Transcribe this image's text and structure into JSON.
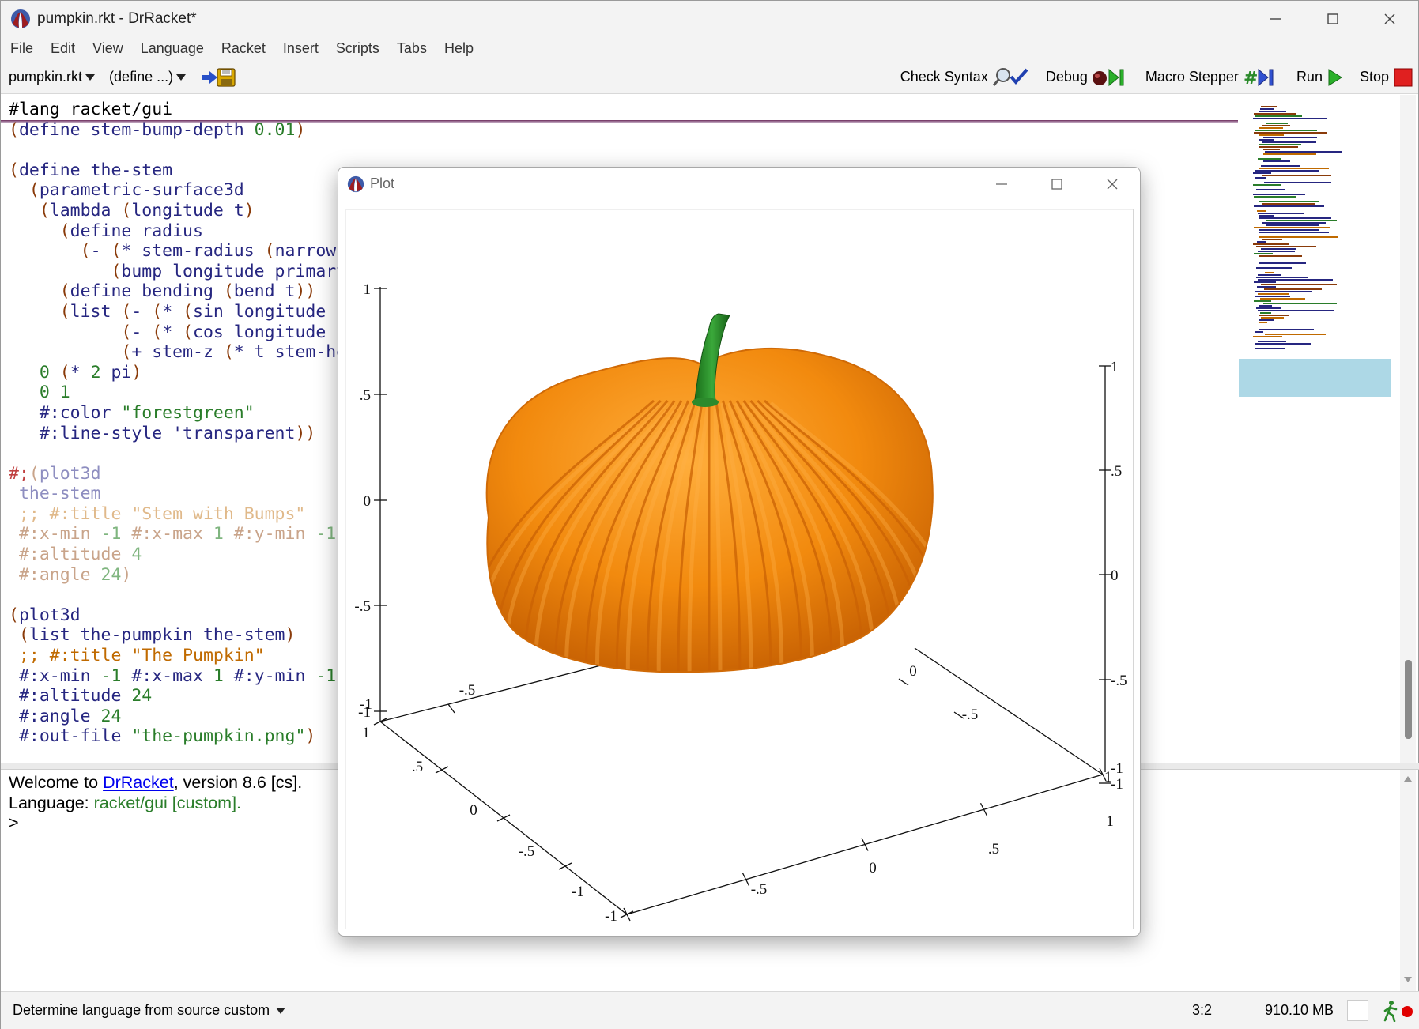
{
  "window": {
    "title": "pumpkin.rkt - DrRacket*"
  },
  "menu": [
    "File",
    "Edit",
    "View",
    "Language",
    "Racket",
    "Insert",
    "Scripts",
    "Tabs",
    "Help"
  ],
  "toolbar": {
    "file_dropdown": "pumpkin.rkt",
    "define_dropdown": "(define ...)",
    "check_syntax": "Check Syntax",
    "debug": "Debug",
    "macro_stepper": "Macro Stepper",
    "run": "Run",
    "stop": "Stop"
  },
  "editor": {
    "lines": [
      [
        {
          "t": "#lang racket/gui",
          "c": "c-blk"
        }
      ],
      [
        {
          "t": "(",
          "c": "c-par"
        },
        {
          "t": "define stem-bump-depth ",
          "c": "c-kw"
        },
        {
          "t": "0.01",
          "c": "c-num"
        },
        {
          "t": ")",
          "c": "c-par"
        }
      ],
      [],
      [
        {
          "t": "(",
          "c": "c-par"
        },
        {
          "t": "define the-stem",
          "c": "c-kw"
        }
      ],
      [
        {
          "t": "  (",
          "c": "c-par"
        },
        {
          "t": "parametric-surface3d",
          "c": "c-kw"
        }
      ],
      [
        {
          "t": "   (",
          "c": "c-par"
        },
        {
          "t": "lambda ",
          "c": "c-kw"
        },
        {
          "t": "(",
          "c": "c-par"
        },
        {
          "t": "longitude t",
          "c": "c-kw"
        },
        {
          "t": ")",
          "c": "c-par"
        }
      ],
      [
        {
          "t": "     (",
          "c": "c-par"
        },
        {
          "t": "define radius",
          "c": "c-kw"
        }
      ],
      [
        {
          "t": "       (",
          "c": "c-par"
        },
        {
          "t": "- ",
          "c": "c-kw"
        },
        {
          "t": "(",
          "c": "c-par"
        },
        {
          "t": "* stem-radius ",
          "c": "c-kw"
        },
        {
          "t": "(",
          "c": "c-par"
        },
        {
          "t": "narrow t",
          "c": "c-kw"
        }
      ],
      [
        {
          "t": "          (",
          "c": "c-par"
        },
        {
          "t": "bump longitude primary",
          "c": "c-kw"
        }
      ],
      [
        {
          "t": "     (",
          "c": "c-par"
        },
        {
          "t": "define bending ",
          "c": "c-kw"
        },
        {
          "t": "(",
          "c": "c-par"
        },
        {
          "t": "bend t",
          "c": "c-kw"
        },
        {
          "t": "))",
          "c": "c-par"
        }
      ],
      [
        {
          "t": "     (",
          "c": "c-par"
        },
        {
          "t": "list ",
          "c": "c-kw"
        },
        {
          "t": "(",
          "c": "c-par"
        },
        {
          "t": "- ",
          "c": "c-kw"
        },
        {
          "t": "(",
          "c": "c-par"
        },
        {
          "t": "* ",
          "c": "c-kw"
        },
        {
          "t": "(",
          "c": "c-par"
        },
        {
          "t": "sin longitude",
          "c": "c-kw"
        }
      ],
      [
        {
          "t": "           (",
          "c": "c-par"
        },
        {
          "t": "- ",
          "c": "c-kw"
        },
        {
          "t": "(",
          "c": "c-par"
        },
        {
          "t": "* ",
          "c": "c-kw"
        },
        {
          "t": "(",
          "c": "c-par"
        },
        {
          "t": "cos longitude",
          "c": "c-kw"
        }
      ],
      [
        {
          "t": "           (",
          "c": "c-par"
        },
        {
          "t": "+ stem-z ",
          "c": "c-kw"
        },
        {
          "t": "(",
          "c": "c-par"
        },
        {
          "t": "* t stem-height",
          "c": "c-kw"
        }
      ],
      [
        {
          "t": "   ",
          "c": "c-blk"
        },
        {
          "t": "0",
          "c": "c-num"
        },
        {
          "t": " (",
          "c": "c-par"
        },
        {
          "t": "* ",
          "c": "c-kw"
        },
        {
          "t": "2",
          "c": "c-num"
        },
        {
          "t": " pi",
          "c": "c-kw"
        },
        {
          "t": ")",
          "c": "c-par"
        }
      ],
      [
        {
          "t": "   ",
          "c": "c-blk"
        },
        {
          "t": "0 1",
          "c": "c-num"
        }
      ],
      [
        {
          "t": "   #:color ",
          "c": "c-kw"
        },
        {
          "t": "\"forestgreen\"",
          "c": "c-str"
        }
      ],
      [
        {
          "t": "   #:line-style ",
          "c": "c-kw"
        },
        {
          "t": "'transparent",
          "c": "c-kw"
        },
        {
          "t": "))",
          "c": "c-par"
        }
      ],
      [],
      [
        {
          "t": "#;",
          "c": "c-dim-red"
        },
        {
          "t": "(",
          "c": "c-dim-par"
        },
        {
          "t": "plot3d",
          "c": "c-dim-kw"
        }
      ],
      [
        {
          "t": " the-stem",
          "c": "c-dim-kw"
        }
      ],
      [
        {
          "t": " ;; #:title \"Stem with Bumps\"",
          "c": "c-dim-com"
        }
      ],
      [
        {
          "t": " #:x-min ",
          "c": "c-dim-par"
        },
        {
          "t": "-1",
          "c": "c-dim-num"
        },
        {
          "t": " #:x-max ",
          "c": "c-dim-par"
        },
        {
          "t": "1",
          "c": "c-dim-num"
        },
        {
          "t": " #:y-min ",
          "c": "c-dim-par"
        },
        {
          "t": "-1",
          "c": "c-dim-num"
        }
      ],
      [
        {
          "t": " #:altitude ",
          "c": "c-dim-par"
        },
        {
          "t": "4",
          "c": "c-dim-num"
        }
      ],
      [
        {
          "t": " #:angle ",
          "c": "c-dim-par"
        },
        {
          "t": "24",
          "c": "c-dim-num"
        },
        {
          "t": ")",
          "c": "c-dim-par"
        }
      ],
      [],
      [
        {
          "t": "(",
          "c": "c-par"
        },
        {
          "t": "plot3d",
          "c": "c-kw"
        }
      ],
      [
        {
          "t": " (",
          "c": "c-par"
        },
        {
          "t": "list the-pumpkin the-stem",
          "c": "c-kw"
        },
        {
          "t": ")",
          "c": "c-par"
        }
      ],
      [
        {
          "t": " ;; #:title \"The Pumpkin\"",
          "c": "c-comment"
        }
      ],
      [
        {
          "t": " #:x-min ",
          "c": "c-kw"
        },
        {
          "t": "-1",
          "c": "c-num"
        },
        {
          "t": " #:x-max ",
          "c": "c-kw"
        },
        {
          "t": "1",
          "c": "c-num"
        },
        {
          "t": " #:y-min ",
          "c": "c-kw"
        },
        {
          "t": "-1",
          "c": "c-num"
        }
      ],
      [
        {
          "t": " #:altitude ",
          "c": "c-kw"
        },
        {
          "t": "24",
          "c": "c-num"
        }
      ],
      [
        {
          "t": " #:angle ",
          "c": "c-kw"
        },
        {
          "t": "24",
          "c": "c-num"
        }
      ],
      [
        {
          "t": " #:out-file ",
          "c": "c-kw"
        },
        {
          "t": "\"the-pumpkin.png\"",
          "c": "c-str"
        },
        {
          "t": ")",
          "c": "c-par"
        }
      ]
    ]
  },
  "repl": {
    "welcome_prefix": "Welcome to ",
    "welcome_link": "DrRacket",
    "welcome_suffix": ", version 8.6 [cs].",
    "language_prefix": "Language: ",
    "language_value": "racket/gui [custom]",
    "language_suffix": ".",
    "prompt": ">"
  },
  "statusbar": {
    "language": "Determine language from source custom",
    "position": "3:2",
    "memory": "910.10 MB"
  },
  "plot_window": {
    "title": "Plot",
    "left_axis_labels": [
      "1",
      ".5",
      "0",
      "-.5",
      "-1"
    ],
    "right_axis_labels": [
      "1",
      ".5",
      "0",
      "-.5",
      "-1"
    ],
    "x_axis_labels": [
      "-1",
      "-.5",
      "0",
      ".5",
      "1"
    ],
    "y_axis_labels_front_left": [
      "1",
      ".5",
      "0",
      "-.5",
      "-1"
    ],
    "y_axis_labels_back_left": [
      "-1",
      "-.5"
    ],
    "x_axis_labels_back_right": [
      "0",
      "-.5",
      "-1"
    ],
    "x_axis_labels_front_right": [
      "1"
    ],
    "colors": {
      "pumpkin": "#f28a0e",
      "pumpkin_dark": "#c45e02",
      "pumpkin_light": "#ffae3c",
      "stem": "#228b22"
    }
  }
}
